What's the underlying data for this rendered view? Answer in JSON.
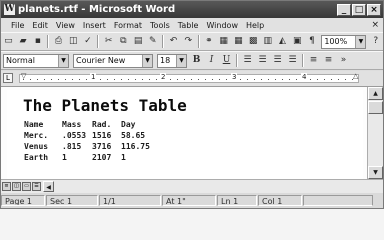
{
  "window": {
    "title": "planets.rtf - Microsoft Word",
    "app_icon": "word-icon",
    "controls": [
      "minimize-icon",
      "maximize-icon",
      "close-icon"
    ]
  },
  "menu": {
    "items": [
      "File",
      "Edit",
      "View",
      "Insert",
      "Format",
      "Tools",
      "Table",
      "Window",
      "Help"
    ],
    "close_doc": "×"
  },
  "toolbar_standard": {
    "zoom": "100%",
    "help_icon": "?"
  },
  "toolbar_formatting": {
    "style": "Normal",
    "font": "Courier New",
    "size": "18",
    "bold": "B",
    "italic": "I",
    "underline": "U"
  },
  "ruler": {
    "numbers": [
      "1",
      "2",
      "3",
      "4"
    ]
  },
  "document": {
    "title": "The Planets Table",
    "table": {
      "header": [
        "Name",
        "Mass",
        "Rad.",
        "Day"
      ],
      "rows": [
        [
          "Merc.",
          ".0553",
          "1516",
          "58.65"
        ],
        [
          "Venus",
          ".815",
          "3716",
          "116.75"
        ],
        [
          "Earth",
          "1",
          "2107",
          "1"
        ]
      ]
    }
  },
  "statusbar": {
    "page": "Page 1",
    "section": "Sec 1",
    "page_of": "1/1",
    "at": "At 1\"",
    "line": "Ln 1",
    "col": "Col 1"
  }
}
